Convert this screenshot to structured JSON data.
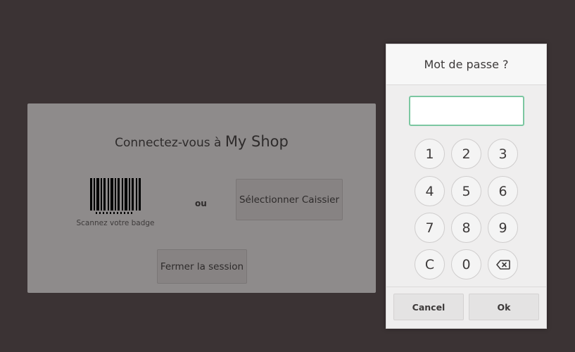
{
  "login": {
    "title_prefix": "Connectez-vous à",
    "shop_name": "My Shop",
    "badge_label": "Scannez votre badge",
    "or_label": "ou",
    "select_cashier_label": "Sélectionner Caissier",
    "close_session_label": "Fermer la session"
  },
  "password_modal": {
    "title": "Mot de passe ?",
    "input_value": "",
    "keys": [
      "1",
      "2",
      "3",
      "4",
      "5",
      "6",
      "7",
      "8",
      "9",
      "C",
      "0",
      "⌫"
    ],
    "cancel_label": "Cancel",
    "ok_label": "Ok"
  },
  "colors": {
    "background": "#3b3334",
    "input_focus_border": "#7cc7a1"
  }
}
